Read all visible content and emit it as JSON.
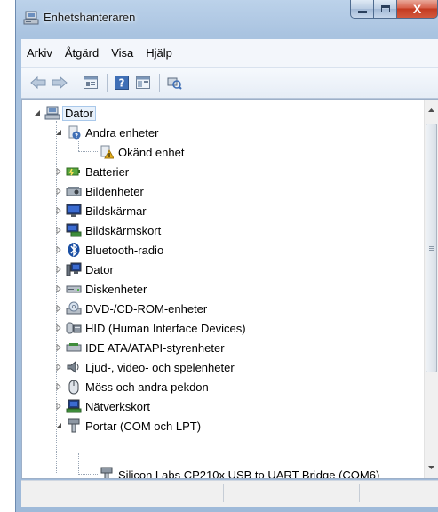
{
  "window": {
    "title": "Enhetshanteraren",
    "close_glyph": "X"
  },
  "menu": [
    "Arkiv",
    "Åtgärd",
    "Visa",
    "Hjälp"
  ],
  "toolbar": {
    "buttons": [
      "back-arrow-icon",
      "forward-arrow-icon",
      "properties-icon",
      "help-icon",
      "console-tree-icon",
      "scan-hardware-icon"
    ]
  },
  "tree": {
    "root": "Dator",
    "groups": [
      {
        "label": "Andra enheter",
        "expanded": true,
        "children": [
          "Okänd enhet"
        ]
      },
      {
        "label": "Batterier"
      },
      {
        "label": "Bildenheter"
      },
      {
        "label": "Bildskärmar"
      },
      {
        "label": "Bildskärmskort"
      },
      {
        "label": "Bluetooth-radio"
      },
      {
        "label": "Dator"
      },
      {
        "label": "Diskenheter"
      },
      {
        "label": "DVD-/CD-ROM-enheter"
      },
      {
        "label": "HID (Human Interface Devices)"
      },
      {
        "label": "IDE ATA/ATAPI-styrenheter"
      },
      {
        "label": "Ljud-, video- och spelenheter"
      },
      {
        "label": "Möss och andra pekdon"
      },
      {
        "label": "Nätverkskort"
      },
      {
        "label": "Portar (COM och LPT)",
        "expanded": true,
        "children": [
          "Silicon Labs CP210x USB to UART Bridge (COM6)"
        ]
      }
    ]
  },
  "colors": {
    "title_bar": "#a9c3e0",
    "close_button": "#c33b21",
    "selection": "#e8f1fb",
    "warning": "#e8b21b"
  }
}
